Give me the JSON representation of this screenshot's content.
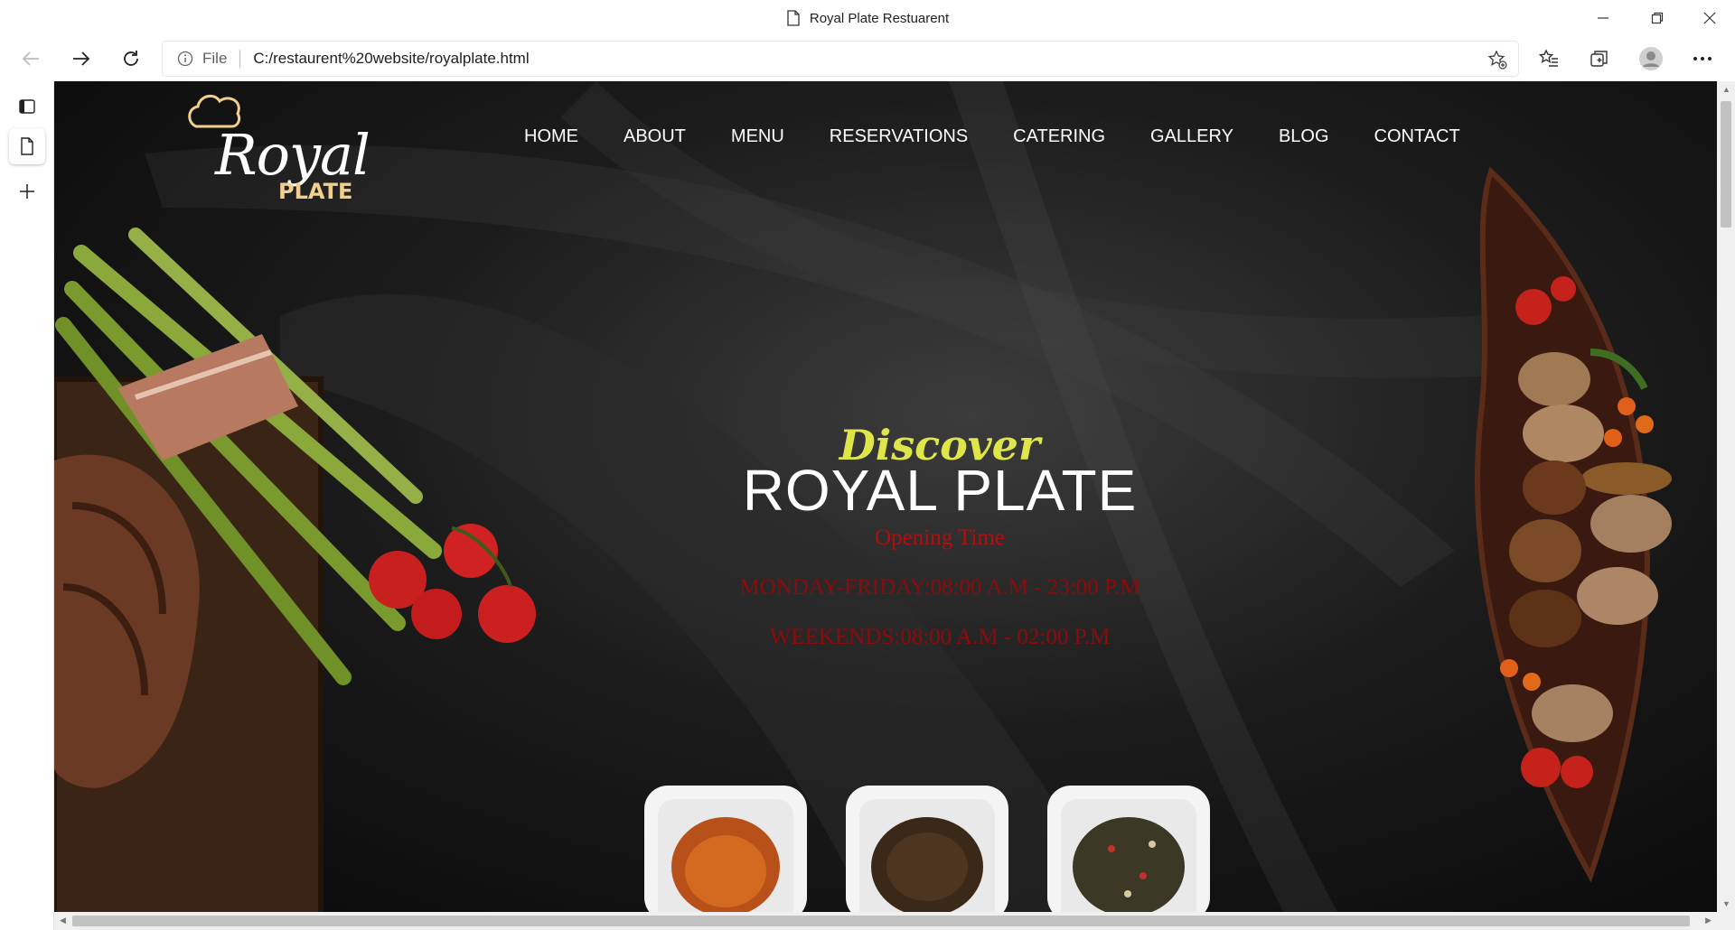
{
  "window": {
    "title": "Royal Plate Restuarent"
  },
  "toolbar": {
    "scheme_label": "File",
    "url": "C:/restaurent%20website/royalplate.html"
  },
  "site": {
    "logo_main": "Royal",
    "logo_sub": "PLATE",
    "nav": [
      "HOME",
      "ABOUT",
      "MENU",
      "RESERVATIONS",
      "CATERING",
      "GALLERY",
      "BLOG",
      "CONTACT"
    ],
    "hero": {
      "kicker": "Discover",
      "title": "ROYAL PLATE",
      "opening_label": "Opening Time",
      "weekday_hours": "MONDAY-FRIDAY:08:00 A.M - 23:00 P.M",
      "weekend_hours": "WEEKENDS:08:00 A.M - 02:00 P.M"
    }
  },
  "colors": {
    "accent_yellow": "#dfe64a",
    "hours_red": "#8e0b0b",
    "logo_gold": "#f2cf8c"
  }
}
